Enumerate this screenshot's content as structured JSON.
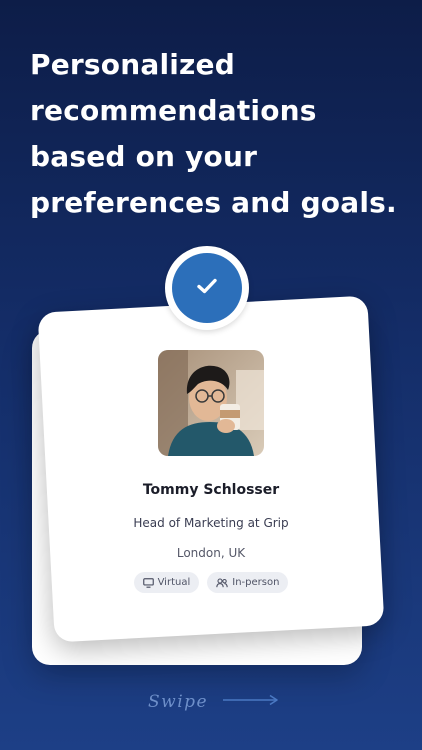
{
  "headline": "Personalized recommendations based on your preferences and goals.",
  "profile": {
    "name": "Tommy Schlosser",
    "role": "Head of Marketing at Grip",
    "location": "London, UK",
    "tags": [
      {
        "label": "Virtual",
        "icon": "monitor-icon"
      },
      {
        "label": "In-person",
        "icon": "people-icon"
      }
    ]
  },
  "badge": {
    "icon": "checkmark-icon",
    "color": "#2c6fba"
  },
  "swipe": {
    "label": "Swipe",
    "icon": "arrow-right-icon"
  },
  "colors": {
    "background_top": "#0d1d48",
    "background_bottom": "#1d3f86",
    "accent": "#2c6fba",
    "swipe": "#6e8fc9"
  }
}
